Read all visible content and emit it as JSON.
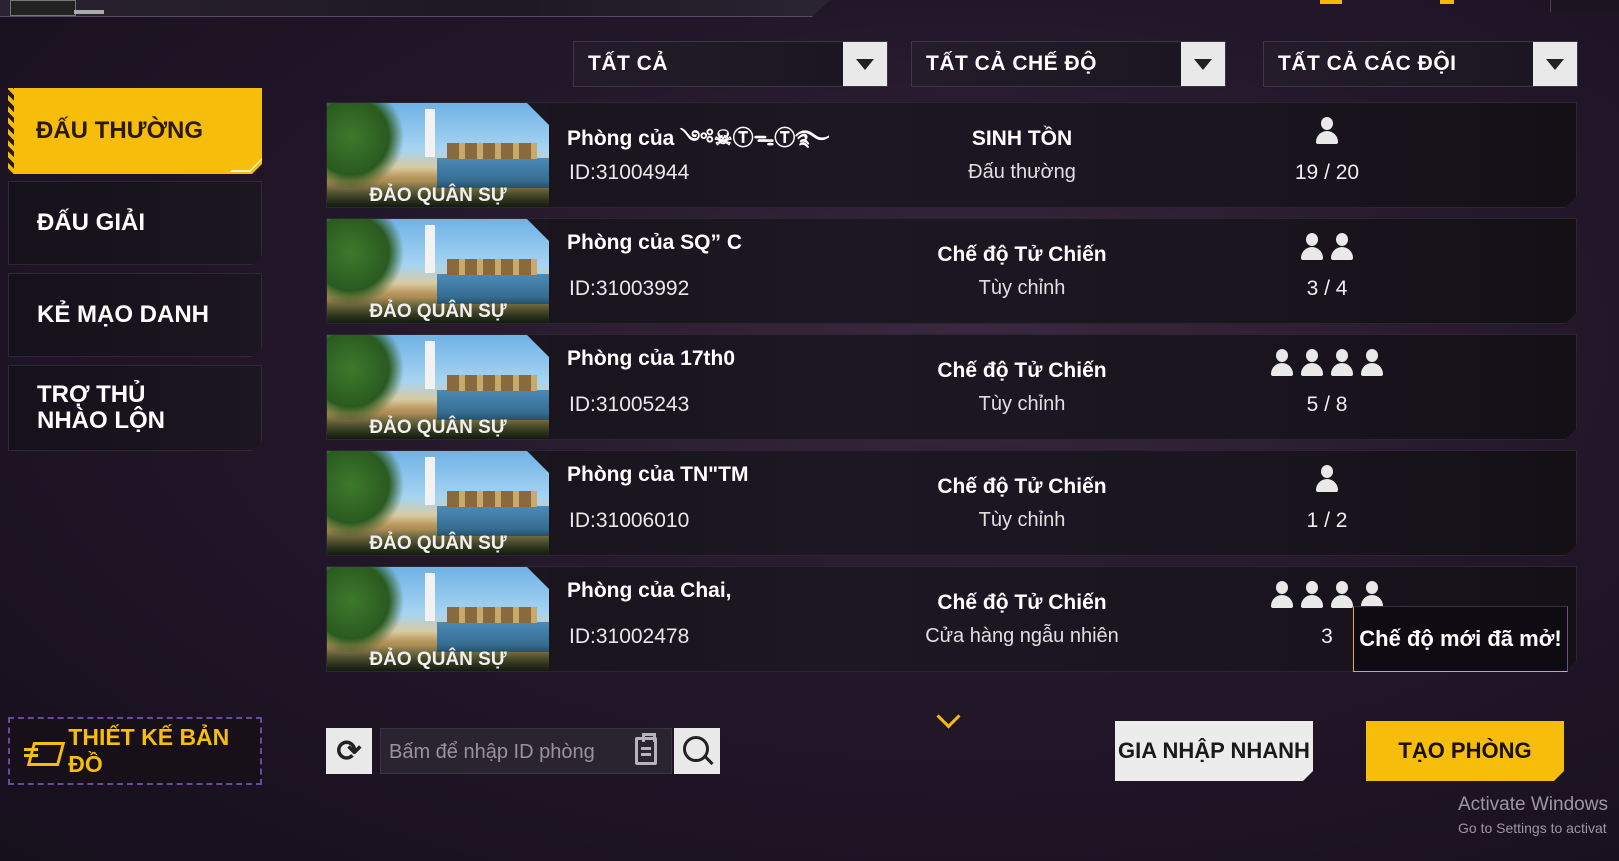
{
  "filters": [
    {
      "label": "TẤT CẢ"
    },
    {
      "label": "TẤT CẢ CHẾ ĐỘ"
    },
    {
      "label": "TẤT CẢ CÁC ĐỘI"
    }
  ],
  "sidebar": {
    "items": [
      {
        "label": "ĐẤU THƯỜNG",
        "active": true
      },
      {
        "label": "ĐẤU GIẢI",
        "active": false
      },
      {
        "label": "KẺ MẠO DANH",
        "active": false
      },
      {
        "label": "TRỢ THỦ NHÀO LỘN",
        "active": false
      }
    ]
  },
  "rooms": [
    {
      "name": "Phòng của ༺☠ⓉᯓⓉ࿐",
      "id": "ID:31004944",
      "mode": "SINH TỒN",
      "submode": "Đấu thường",
      "players": "19 / 20",
      "player_icons": 1,
      "map": "ĐẢO QUÂN SỰ"
    },
    {
      "name": "Phòng của SQ”    C",
      "id": "ID:31003992",
      "mode": "Chế độ Tử Chiến",
      "submode": "Tùy chỉnh",
      "players": "3 / 4",
      "player_icons": 2,
      "map": "ĐẢO QUÂN SỰ"
    },
    {
      "name": "Phòng của 17th0",
      "id": "ID:31005243",
      "mode": "Chế độ Tử Chiến",
      "submode": "Tùy chỉnh",
      "players": "5 / 8",
      "player_icons": 4,
      "map": "ĐẢO QUÂN SỰ"
    },
    {
      "name": "Phòng của TN\"TM",
      "id": "ID:31006010",
      "mode": "Chế độ Tử Chiến",
      "submode": "Tùy chỉnh",
      "players": "1 / 2",
      "player_icons": 1,
      "map": "ĐẢO QUÂN SỰ"
    },
    {
      "name": "Phòng của Chai,",
      "id": "ID:31002478",
      "mode": "Chế độ Tử Chiến",
      "submode": "Cửa hàng ngẫu nhiên",
      "players": "3",
      "player_icons": 4,
      "map": "ĐẢO QUÂN SỰ"
    }
  ],
  "tooltip": "Chế độ mới đã mở!",
  "bottom": {
    "map_design_label": "THIẾT KẾ BẢN ĐỒ",
    "search_placeholder": "Bấm để nhập ID phòng",
    "quick_join_label": "GIA NHẬP NHANH",
    "create_room_label": "TẠO PHÒNG"
  },
  "watermark": {
    "line1": "Activate Windows",
    "line2": "Go to Settings to activat"
  },
  "colors": {
    "accent": "#f6bd0b",
    "background": "#23172a"
  }
}
